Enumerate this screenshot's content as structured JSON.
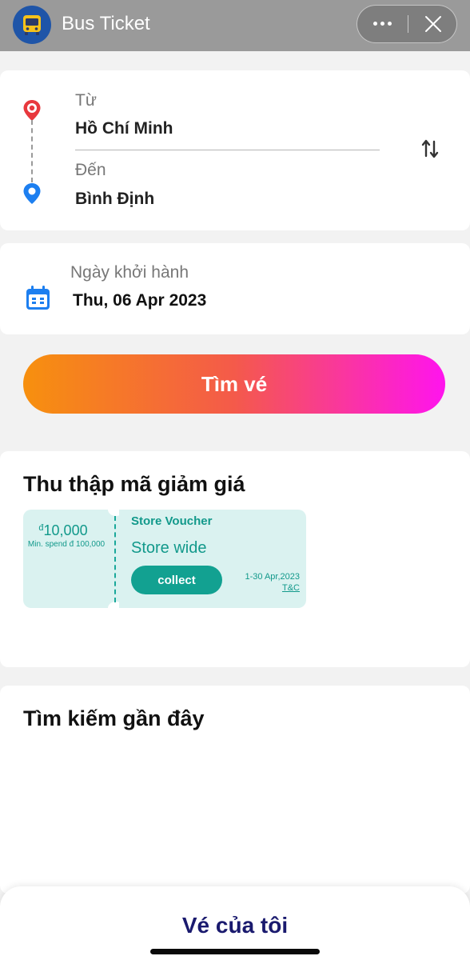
{
  "header": {
    "title": "Bus Ticket",
    "app_icon": "bus-icon",
    "more_icon": "more-dots-icon",
    "close_icon": "close-icon"
  },
  "route": {
    "from_label": "Từ",
    "from_value": "Hồ Chí Minh",
    "to_label": "Đến",
    "to_value": "Bình Định",
    "swap_icon": "swap-arrows-icon"
  },
  "date": {
    "label": "Ngày khởi hành",
    "value": "Thu, 06 Apr 2023",
    "icon": "calendar-icon"
  },
  "search_button": {
    "label": "Tìm vé"
  },
  "vouchers": {
    "title": "Thu thập mã giảm giá",
    "items": [
      {
        "currency": "đ",
        "amount": "10,000",
        "min_spend": "Min. spend đ 100,000",
        "name": "Store Voucher",
        "scope": "Store wide",
        "button": "collect",
        "validity": "1-30 Apr,2023",
        "terms": "T&C"
      }
    ]
  },
  "recent": {
    "title": "Tìm kiếm gần đây"
  },
  "bottom": {
    "my_tickets": "Vé của tôi"
  },
  "colors": {
    "header_bg": "#9a9a9a",
    "brand_blue": "#1f55a8",
    "teal": "#12998b",
    "gradient_start": "#f7900e",
    "gradient_end": "#ff14ee",
    "bottom_text": "#1a1a6e"
  }
}
